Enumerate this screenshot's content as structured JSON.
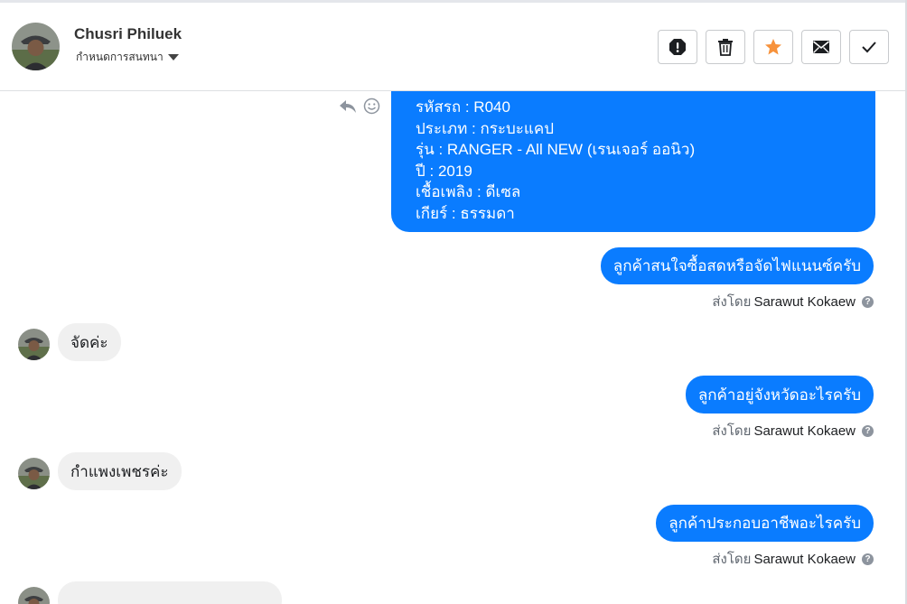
{
  "header": {
    "contact_name": "Chusri Philuek",
    "conversation_setting_label": "กำหนดการสนทนา",
    "actions": [
      {
        "name": "mark-spam",
        "icon": "alert-icon"
      },
      {
        "name": "delete",
        "icon": "trash-icon"
      },
      {
        "name": "star",
        "icon": "star-icon",
        "color": "#f7923b"
      },
      {
        "name": "mark-unread",
        "icon": "envelope-icon"
      },
      {
        "name": "mark-done",
        "icon": "checkmark-icon"
      }
    ]
  },
  "colors": {
    "outgoing_bubble": "#0a7cff",
    "incoming_bubble": "#f0f0f0"
  },
  "messages": {
    "car_card": {
      "lines": [
        "รหัสรถ : R040",
        "ประเภท : กระบะแคป",
        "รุ่น : RANGER - All NEW (เรนเจอร์ ออนิว)",
        "ปี : 2019",
        "เชื้อเพลิง : ดีเซล",
        "เกียร์ : ธรรมดา"
      ]
    },
    "out_1": {
      "text": "ลูกค้าสนใจซื้อสดหรือจัดไฟแนนซ์ครับ"
    },
    "in_1": {
      "text": "จัดค่ะ"
    },
    "out_2": {
      "text": "ลูกค้าอยู่จังหวัดอะไรครับ"
    },
    "in_2": {
      "text": "กำแพงเพชรค่ะ"
    },
    "out_3": {
      "text": "ลูกค้าประกอบอาชีพอะไรครับ"
    },
    "sent_by_prefix": "ส่งโดย",
    "sent_by_agent": "Sarawut Kokaew"
  }
}
